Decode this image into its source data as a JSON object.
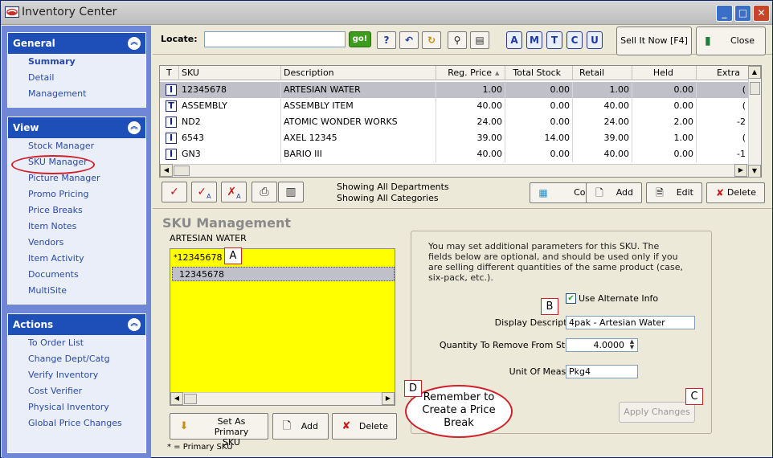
{
  "window": {
    "title": "Inventory Center"
  },
  "sidebar": {
    "general": {
      "title": "General",
      "items": [
        "Summary",
        "Detail",
        "Management"
      ]
    },
    "view": {
      "title": "View",
      "items": [
        "Stock Manager",
        "SKU Manager",
        "Picture Manager",
        "Promo Pricing",
        "Price Breaks",
        "Item Notes",
        "Vendors",
        "Item Activity",
        "Documents",
        "MultiSite"
      ]
    },
    "actions": {
      "title": "Actions",
      "items": [
        "To Order List",
        "Change Dept/Catg",
        "Verify Inventory",
        "Cost Verifier",
        "Physical Inventory",
        "Global Price Changes"
      ]
    }
  },
  "toolbar": {
    "locate_label": "Locate:",
    "go_label": "go!",
    "letters": [
      "A",
      "M",
      "T",
      "C",
      "U"
    ],
    "sell_label": "Sell It Now [F4]",
    "close_label": "Close"
  },
  "grid": {
    "columns": [
      "T",
      "SKU",
      "Description",
      "Reg. Price",
      "Total Stock",
      "Retail",
      "Held",
      "Extra"
    ],
    "rows": [
      {
        "t": "I",
        "sku": "12345678",
        "desc": "ARTESIAN WATER",
        "price": "1.00",
        "stock": "0.00",
        "retail": "1.00",
        "held": "0.00",
        "extra": "("
      },
      {
        "t": "T",
        "sku": "ASSEMBLY",
        "desc": "ASSEMBLY ITEM",
        "price": "40.00",
        "stock": "0.00",
        "retail": "40.00",
        "held": "0.00",
        "extra": "("
      },
      {
        "t": "I",
        "sku": "ND2",
        "desc": "ATOMIC WONDER WORKS",
        "price": "24.00",
        "stock": "0.00",
        "retail": "24.00",
        "held": "2.00",
        "extra": "-2"
      },
      {
        "t": "I",
        "sku": "6543",
        "desc": "AXEL 12345",
        "price": "39.00",
        "stock": "14.00",
        "retail": "39.00",
        "held": "1.00",
        "extra": "("
      },
      {
        "t": "I",
        "sku": "GN3",
        "desc": "BARIO III",
        "price": "40.00",
        "stock": "0.00",
        "retail": "40.00",
        "held": "0.00",
        "extra": "-1"
      }
    ]
  },
  "filter": {
    "line1": "Showing All Departments",
    "line2": "Showing All Categories"
  },
  "actions_row": {
    "copy": "Copy",
    "add": "Add",
    "edit": "Edit",
    "delete": "Delete"
  },
  "sku_panel": {
    "title": "SKU Management",
    "item_name": "ARTESIAN WATER",
    "list": [
      {
        "marker": "*",
        "value": "12345678"
      },
      {
        "marker": "",
        "value": "12345678"
      }
    ],
    "set_primary_line1": "Set As Primary",
    "set_primary_line2": "SKU",
    "add": "Add",
    "delete": "Delete",
    "note": "* = Primary SKU",
    "description": "You may set additional parameters for this SKU.  The fields below are optional, and should be used only if you are selling different quantities of the same product (case, six-pack, etc.).",
    "use_alternate_label": "Use Alternate Info",
    "use_alternate_checked": true,
    "display_desc_label": "Display Description:",
    "display_desc_value": "4pak - Artesian Water",
    "qty_label": "Quantity To Remove From Stock:",
    "qty_value": "4.0000",
    "uom_label": "Unit Of Measure:",
    "uom_value": "Pkg4",
    "apply": "Apply Changes"
  },
  "callouts": {
    "a": "A",
    "b": "B",
    "c": "C",
    "d": "D",
    "remember": "Remember to Create a Price Break"
  }
}
